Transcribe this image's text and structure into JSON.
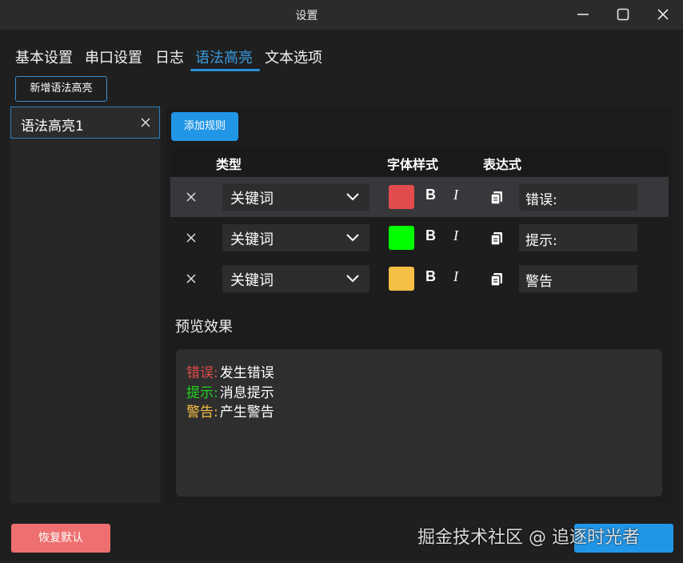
{
  "window": {
    "title": "设置"
  },
  "tabs": [
    {
      "label": "基本设置"
    },
    {
      "label": "串口设置"
    },
    {
      "label": "日志"
    },
    {
      "label": "语法高亮"
    },
    {
      "label": "文本选项"
    }
  ],
  "active_tab": "语法高亮",
  "toolbar": {
    "new_highlight_label": "新增语法高亮",
    "add_rule_label": "添加规则"
  },
  "left_list": {
    "items": [
      {
        "label": "语法高亮1"
      }
    ]
  },
  "table": {
    "headers": {
      "type": "类型",
      "font_style": "字体样式",
      "expression": "表达式"
    },
    "rows": [
      {
        "type": "关键词",
        "color": "#e34c4c",
        "bold": "B",
        "italic": "I",
        "expression": "错误:"
      },
      {
        "type": "关键词",
        "color": "#00ff00",
        "bold": "B",
        "italic": "I",
        "expression": "提示:"
      },
      {
        "type": "关键词",
        "color": "#f5bf45",
        "bold": "B",
        "italic": "I",
        "expression": "警告"
      }
    ]
  },
  "preview": {
    "title": "预览效果",
    "lines": [
      {
        "keyword": "错误:",
        "text": "发生错误",
        "color": "#e34c4c"
      },
      {
        "keyword": "提示:",
        "text": "消息提示",
        "color": "#1fd61f"
      },
      {
        "keyword": "警告:",
        "text": "产生警告",
        "color": "#f5bf45"
      }
    ]
  },
  "footer": {
    "restore_label": "恢复默认"
  },
  "watermark": "掘金技术社区 @ 追逐时光者"
}
